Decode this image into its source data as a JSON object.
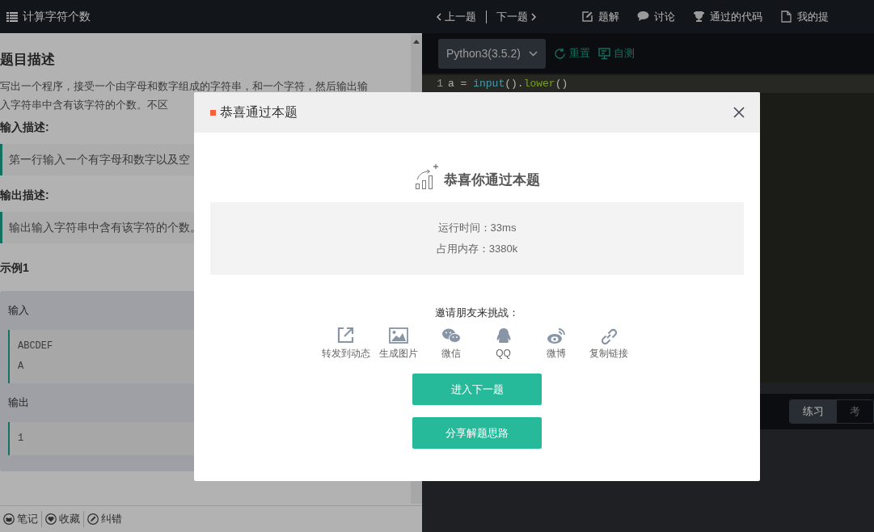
{
  "problem_panel": {
    "title": "计算字符个数",
    "heading": "题目描述",
    "description_lines": [
      "写出一个程序，接受一个由字母和数字组成的字符串，和一个字符，然后输出输",
      "入字符串中含有该字符的个数。不区"
    ],
    "input_label": "输入描述:",
    "input_desc": "第一行输入一个有字母和数字以及空",
    "output_label": "输出描述:",
    "output_desc": "输出输入字符串中含有该字符的个数。",
    "example": {
      "title": "示例1",
      "input_label": "输入",
      "input_lines": [
        "ABCDEF",
        "A"
      ],
      "output_label": "输出",
      "output_lines": [
        "1"
      ]
    },
    "footer": [
      {
        "kind": "note",
        "label": "笔记"
      },
      {
        "kind": "favorite",
        "label": "收藏"
      },
      {
        "kind": "report",
        "label": "纠错"
      }
    ]
  },
  "editor_panel": {
    "prev": "上一题",
    "next": "下一题",
    "nav": [
      {
        "kind": "edit",
        "label": "题解"
      },
      {
        "kind": "chat",
        "label": "讨论"
      },
      {
        "kind": "trophy",
        "label": "通过的代码"
      },
      {
        "kind": "file",
        "label": "我的提"
      }
    ],
    "language": "Python3(3.5.2)",
    "reset": "重置",
    "self_test": "自测",
    "code_lines": [
      {
        "number": "1",
        "tokens": [
          {
            "kind": "plain",
            "text": "a = "
          },
          {
            "kind": "func",
            "text": "input"
          },
          {
            "kind": "plain",
            "text": "()."
          },
          {
            "kind": "method",
            "text": "lower"
          },
          {
            "kind": "plain",
            "text": "()"
          }
        ]
      }
    ],
    "mode_tabs": [
      {
        "label": "练习",
        "selected": true
      },
      {
        "label": "考",
        "selected": false
      }
    ]
  },
  "modal": {
    "title": "恭喜通过本题",
    "headline": "恭喜你通过本题",
    "stats": [
      "运行时间：33ms",
      "占用内存：3380k"
    ],
    "invite": "邀请朋友来挑战：",
    "share": [
      {
        "kind": "forward",
        "label": "转发到动态"
      },
      {
        "kind": "image",
        "label": "生成图片"
      },
      {
        "kind": "wechat",
        "label": "微信"
      },
      {
        "kind": "qq",
        "label": "QQ"
      },
      {
        "kind": "weibo",
        "label": "微博"
      },
      {
        "kind": "link",
        "label": "复制链接"
      }
    ],
    "buttons": [
      "进入下一题",
      "分享解题思路"
    ]
  }
}
